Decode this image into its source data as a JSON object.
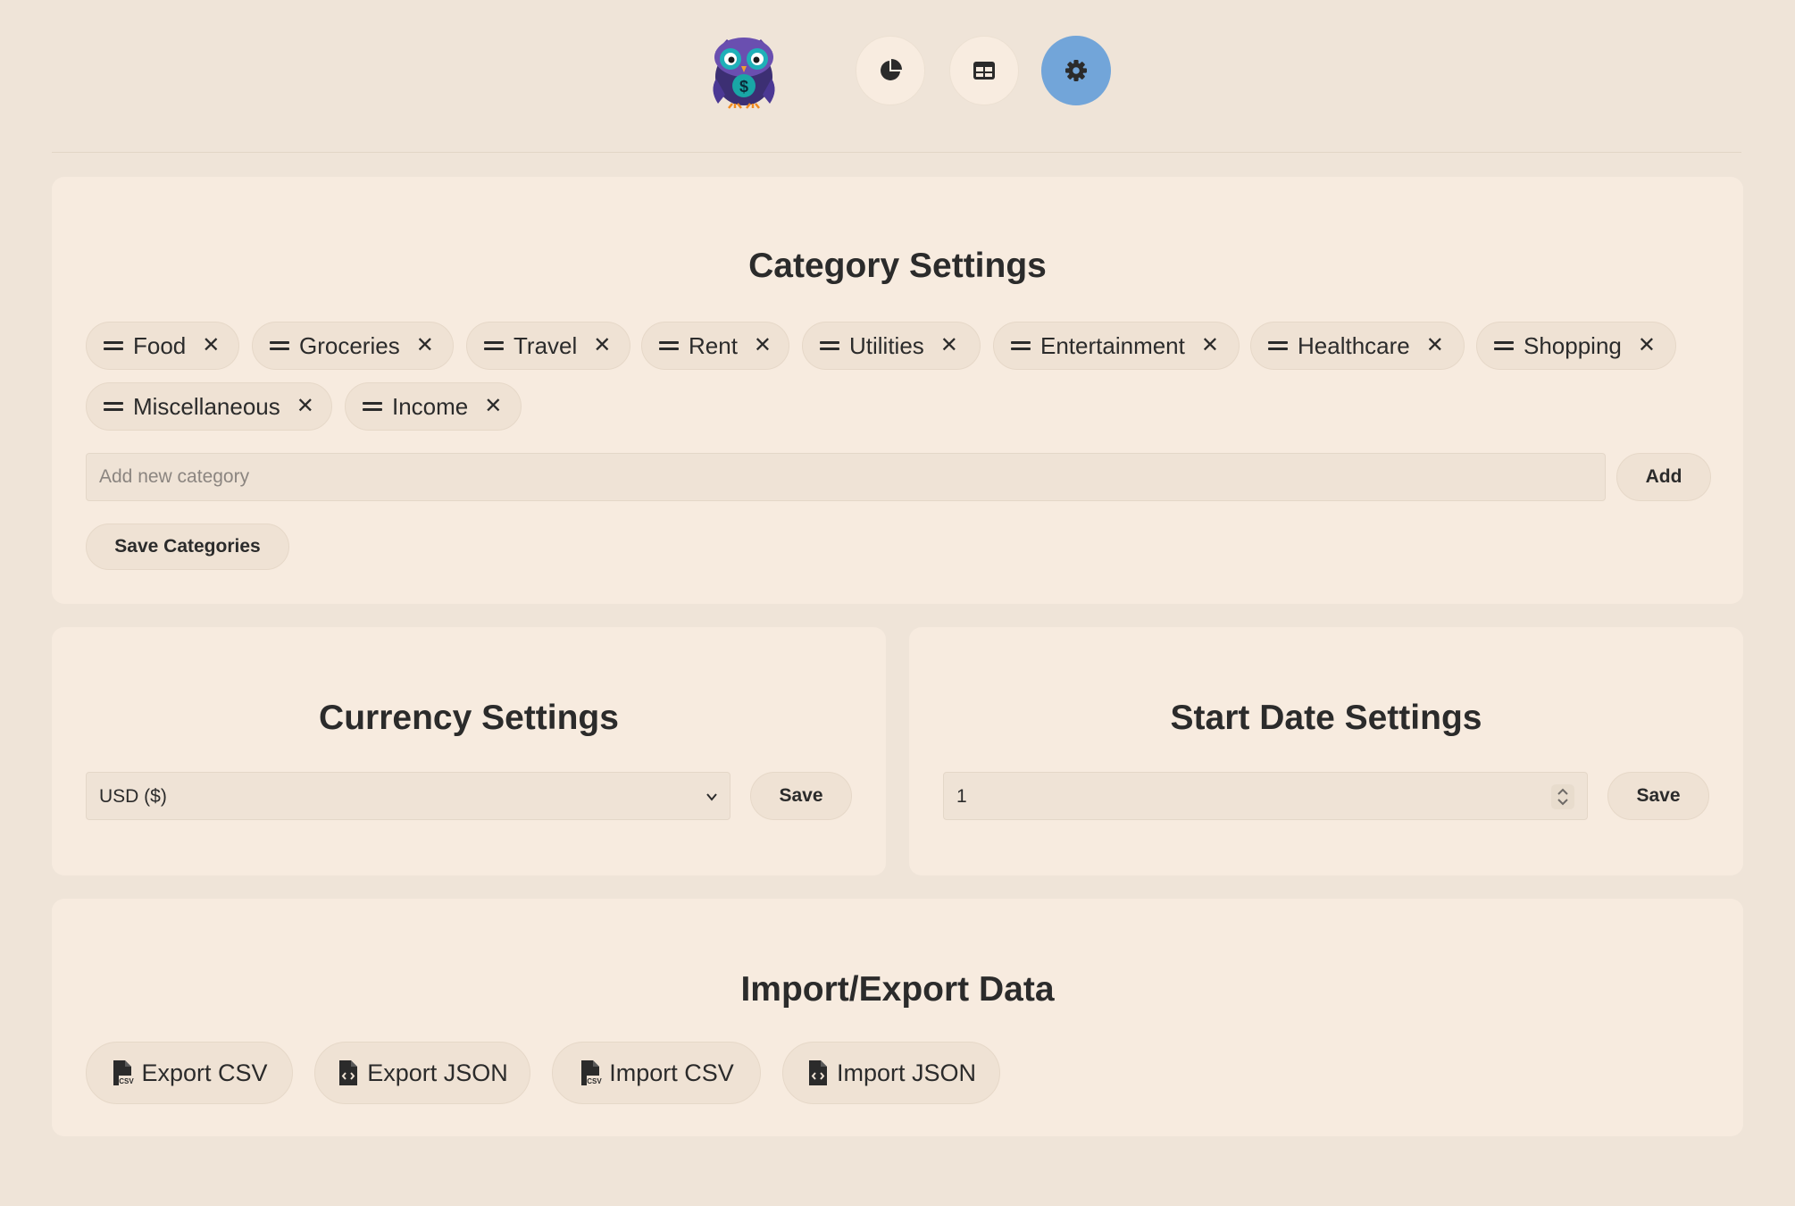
{
  "nav": {
    "logo_alt": "owl logo",
    "buttons": [
      {
        "name": "dashboard",
        "icon": "pie-chart-icon",
        "active": false
      },
      {
        "name": "table",
        "icon": "table-icon",
        "active": false
      },
      {
        "name": "settings",
        "icon": "gear-icon",
        "active": true
      }
    ],
    "active_color": "#72a5d9"
  },
  "category_settings": {
    "title": "Category Settings",
    "categories": [
      "Food",
      "Groceries",
      "Travel",
      "Rent",
      "Utilities",
      "Entertainment",
      "Healthcare",
      "Shopping",
      "Miscellaneous",
      "Income"
    ],
    "new_category_placeholder": "Add new category",
    "add_label": "Add",
    "save_label": "Save Categories"
  },
  "currency_settings": {
    "title": "Currency Settings",
    "selected": "USD ($)",
    "save_label": "Save"
  },
  "start_date_settings": {
    "title": "Start Date Settings",
    "value": "1",
    "save_label": "Save"
  },
  "import_export": {
    "title": "Import/Export Data",
    "buttons": [
      {
        "label": "Export CSV",
        "icon": "csv-file-icon"
      },
      {
        "label": "Export JSON",
        "icon": "json-file-icon"
      },
      {
        "label": "Import CSV",
        "icon": "csv-file-icon"
      },
      {
        "label": "Import JSON",
        "icon": "json-file-icon"
      }
    ]
  }
}
